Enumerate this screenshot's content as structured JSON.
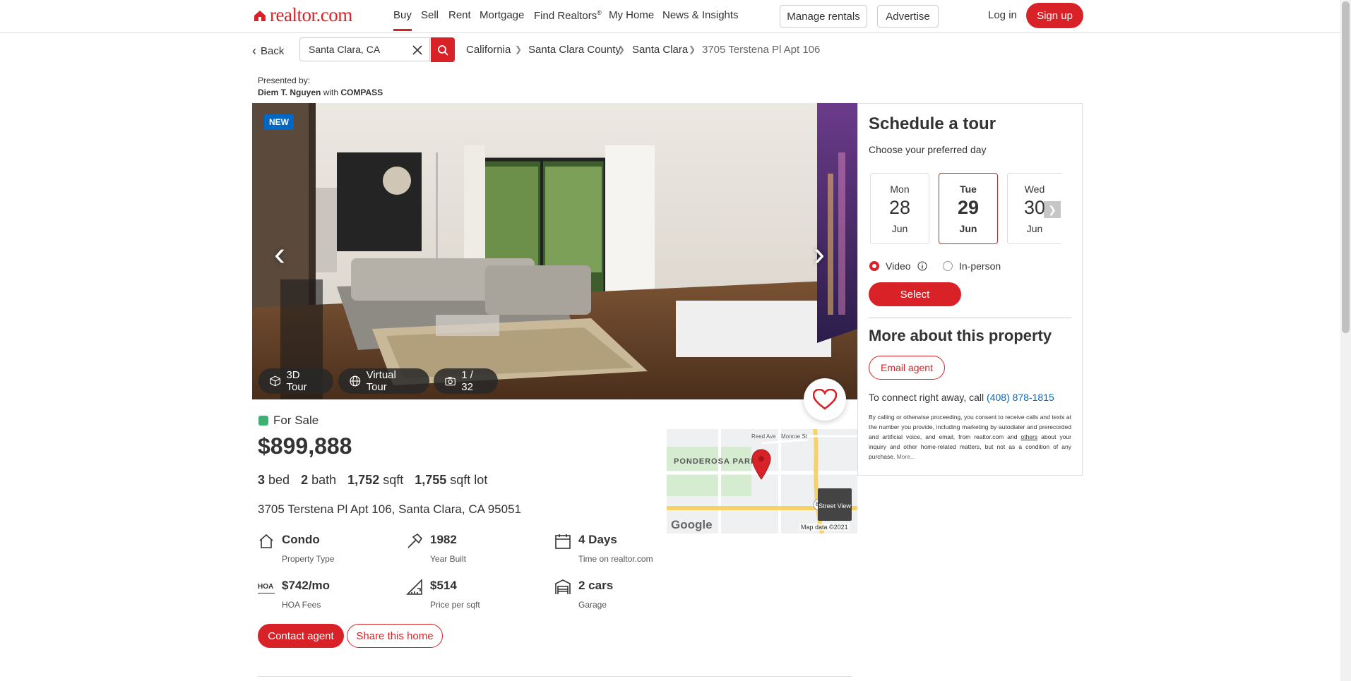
{
  "brand": {
    "name": "realtor.com",
    "accent": "#d92228",
    "link_color": "#0067c5",
    "for_sale_color": "#3bb273"
  },
  "nav": {
    "items": [
      "Buy",
      "Sell",
      "Rent",
      "Mortgage",
      "Find Realtors",
      "My Home",
      "News & Insights"
    ],
    "find_realtors_mark": "®",
    "manage_rentals": "Manage rentals",
    "advertise": "Advertise",
    "login": "Log in",
    "signup": "Sign up"
  },
  "search": {
    "back": "Back",
    "value": "Santa Clara, CA"
  },
  "breadcrumb": [
    "California",
    "Santa Clara County",
    "Santa Clara",
    "3705 Terstena Pl Apt 106"
  ],
  "presented": {
    "label": "Presented by:",
    "agent": "Diem T. Nguyen",
    "with": "with",
    "brokerage": "COMPASS"
  },
  "photo": {
    "badge": "NEW",
    "tour_3d": "3D Tour",
    "virtual_tour": "Virtual Tour",
    "counter": "1 / 32"
  },
  "listing": {
    "status": "For Sale",
    "price": "$899,888",
    "beds": "3",
    "beds_label": "bed",
    "baths": "2",
    "baths_label": "bath",
    "sqft": "1,752",
    "sqft_label": "sqft",
    "lot": "1,755",
    "lot_label": "sqft lot",
    "address": "3705 Terstena Pl Apt 106, Santa Clara, CA 95051"
  },
  "features": [
    {
      "icon": "house-icon",
      "value": "Condo",
      "label": "Property Type"
    },
    {
      "icon": "hammer-icon",
      "value": "1982",
      "label": "Year Built"
    },
    {
      "icon": "calendar-icon",
      "value": "4 Days",
      "label": "Time on realtor.com"
    },
    {
      "icon": "hoa-icon",
      "value": "$742/mo",
      "label": "HOA Fees"
    },
    {
      "icon": "ruler-icon",
      "value": "$514",
      "label": "Price per sqft"
    },
    {
      "icon": "garage-icon",
      "value": "2 cars",
      "label": "Garage"
    }
  ],
  "map": {
    "park": "PONDEROSA PARK",
    "street1": "Reed Ave",
    "street2": "Monroe St",
    "route": "82",
    "street_view": "Street View",
    "attribution": "Map data ©2021",
    "logo": "Google",
    "hoa_icon_text": "HOA"
  },
  "actions": {
    "contact": "Contact agent",
    "share": "Share this home"
  },
  "schedule": {
    "title": "Schedule a tour",
    "subtitle": "Choose your preferred day",
    "days": [
      {
        "name": "Mon",
        "date": "28",
        "month": "Jun"
      },
      {
        "name": "Tue",
        "date": "29",
        "month": "Jun",
        "selected": true
      },
      {
        "name": "Wed",
        "date": "30",
        "month": "Jun"
      }
    ],
    "option_video": "Video",
    "option_inperson": "In-person",
    "select": "Select"
  },
  "more": {
    "title": "More about this property",
    "email": "Email agent",
    "connect": "To connect right away, call",
    "phone": "(408) 878-1815",
    "disclaimer_a": "By calling or otherwise proceeding, you consent to receive calls and texts at the number you provide, including marketing by autodialer and prerecorded and artificial voice, and email, from realtor.com and",
    "disclaimer_link": "others",
    "disclaimer_b": "about your inquiry and other home-related matters, but not as a condition of any purchase.",
    "disclaimer_more": "More..."
  }
}
